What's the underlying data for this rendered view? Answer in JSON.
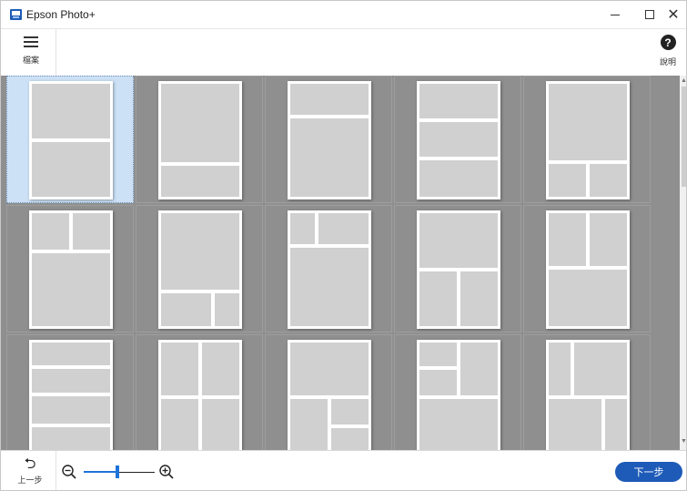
{
  "window": {
    "title": "Epson Photo+",
    "minimize_label": "",
    "maximize_label": "",
    "close_label": "✕"
  },
  "toolbar": {
    "menu_label": "檔案",
    "help_label": "說明",
    "help_glyph": "?"
  },
  "layouts": {
    "selected_index": 0,
    "slot_color": "#d0d0d0",
    "selected_bg": "#cce1f5",
    "items": [
      {
        "name": "layout-2-horizontal"
      },
      {
        "name": "layout-big-top-small-bottom"
      },
      {
        "name": "layout-small-top-big-bottom"
      },
      {
        "name": "layout-3-horizontal"
      },
      {
        "name": "layout-big-top-2-bottom"
      },
      {
        "name": "layout-2-top-big-bottom"
      },
      {
        "name": "layout-big-top-2-bottom-uneven"
      },
      {
        "name": "layout-2-top-uneven-big-bottom"
      },
      {
        "name": "layout-top-wide-2-bottom"
      },
      {
        "name": "layout-2-top-wide-bottom"
      },
      {
        "name": "layout-4-horizontal"
      },
      {
        "name": "layout-2x2"
      },
      {
        "name": "layout-big-top-3-bottom"
      },
      {
        "name": "layout-2-stack-left-big-right"
      },
      {
        "name": "layout-narrow-left-grid"
      }
    ]
  },
  "bottombar": {
    "back_label": "上一步",
    "back_glyph": "⮌",
    "next_label": "下一步",
    "zoom_level": 0.48
  },
  "colors": {
    "accent": "#1e5bb8",
    "content_bg": "#8f8f8f"
  }
}
